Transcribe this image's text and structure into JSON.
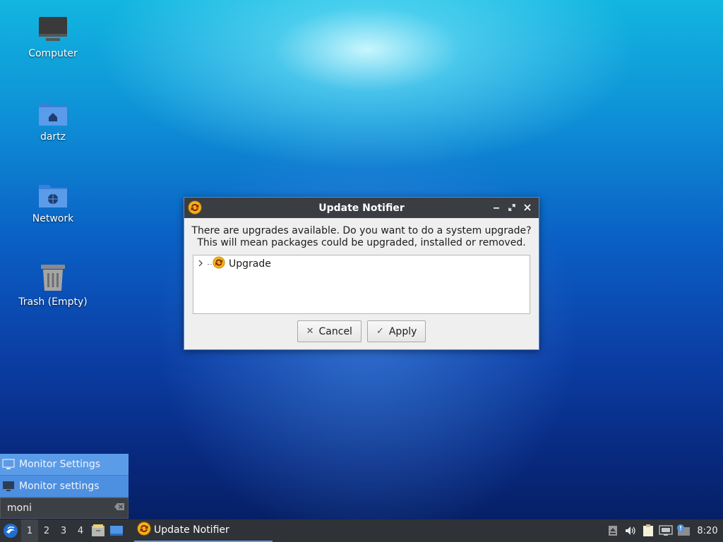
{
  "desktop": {
    "icons": [
      {
        "label": "Computer"
      },
      {
        "label": "dartz"
      },
      {
        "label": "Network"
      },
      {
        "label": "Trash (Empty)"
      }
    ]
  },
  "dialog": {
    "title": "Update Notifier",
    "message_line1": "There are upgrades available. Do you want to do a system upgrade?",
    "message_line2": "This will mean packages could be upgraded, installed or removed.",
    "tree_items": [
      {
        "label": "Upgrade"
      }
    ],
    "cancel_label": "Cancel",
    "apply_label": "Apply"
  },
  "launcher": {
    "results": [
      {
        "label": "Monitor Settings"
      },
      {
        "label": "Monitor settings"
      }
    ],
    "search_value": "moni"
  },
  "taskbar": {
    "workspaces": [
      "1",
      "2",
      "3",
      "4"
    ],
    "active_workspace": "1",
    "task_label": "Update Notifier",
    "clock": "8:20"
  },
  "colors": {
    "accent": "#5b9ce8",
    "titlebar": "#3a3d42",
    "taskbar": "#2f3237"
  }
}
